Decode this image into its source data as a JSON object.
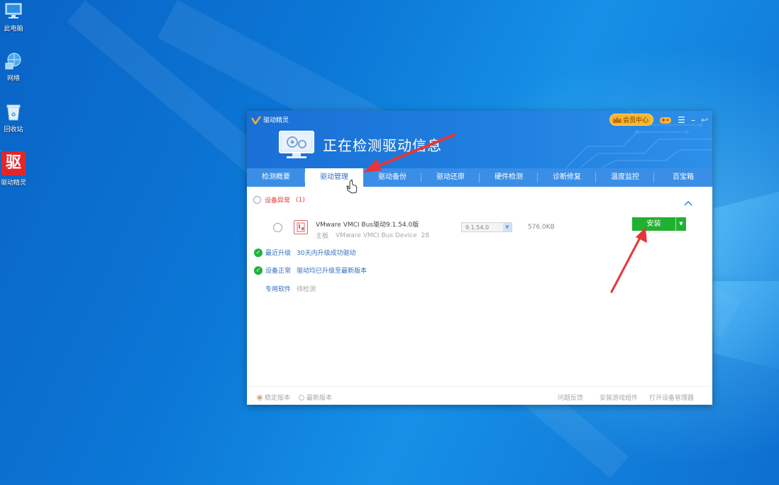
{
  "desktop": {
    "icons": [
      {
        "name": "this-pc",
        "label": "此电脑"
      },
      {
        "name": "network",
        "label": "网络"
      },
      {
        "name": "recycle-bin",
        "label": "回收站"
      },
      {
        "name": "driver-genius",
        "label": "驱动精灵",
        "glyph": "驱"
      }
    ]
  },
  "app": {
    "brand": "驱动精灵",
    "status_title": "正在检测驱动信息",
    "vip_label": "会员中心",
    "controls": {
      "menu": "☰",
      "minimize": "–",
      "back": "↩"
    },
    "tabs": [
      {
        "label": "检测概要",
        "active": false
      },
      {
        "label": "驱动管理",
        "active": true
      },
      {
        "label": "驱动备份",
        "active": false
      },
      {
        "label": "驱动还原",
        "active": false
      },
      {
        "label": "硬件检测",
        "active": false
      },
      {
        "label": "诊断修复",
        "active": false
      },
      {
        "label": "温度监控",
        "active": false
      },
      {
        "label": "百宝箱",
        "active": false
      }
    ],
    "device_abnormal": {
      "label": "设备异常",
      "count": "(1)"
    },
    "driver": {
      "name": "VMware VMCI Bus驱动9.1.54.0版",
      "category": "主板",
      "device": "VMware VMCI Bus Device",
      "device_suffix": "28",
      "version": "9.1.54.0",
      "size": "576.0KB",
      "install_label": "安装",
      "install_dropdown": "▼"
    },
    "recent_upgrade": {
      "label": "最近升级",
      "value": "30天内升级成功驱动"
    },
    "device_normal": {
      "label": "设备正常",
      "value": "驱动均已升级至最新版本"
    },
    "special_software": {
      "label": "专用软件",
      "value": "待检测"
    },
    "footer": {
      "stable_version": "稳定版本",
      "latest_version": "最新版本",
      "feedback": "问题反馈",
      "install_game_components": "安装游戏组件",
      "open_device_manager": "打开设备管理器"
    }
  },
  "colors": {
    "accent_blue": "#1a6fd6",
    "tab_bar": "#3a8ee6",
    "install_green": "#21b131",
    "check_green": "#21b33a",
    "warning_red": "#e23a3a",
    "annotation_red": "#e8353a"
  }
}
